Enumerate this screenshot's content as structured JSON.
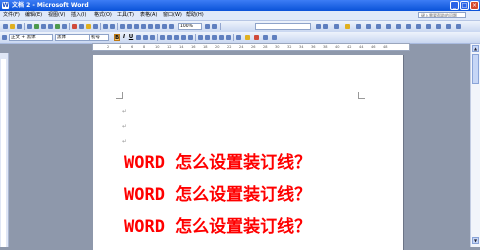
{
  "window": {
    "title": "文档 2 - Microsoft Word",
    "app_icon": "word-icon"
  },
  "menu": [
    "文件(F)",
    "编辑(E)",
    "视图(V)",
    "插入(I)",
    "格式(O)",
    "工具(T)",
    "表格(A)",
    "窗口(W)",
    "帮助(H)"
  ],
  "help_box": {
    "placeholder": "键入需要帮助的问题"
  },
  "toolbar": {
    "zoom": "100%"
  },
  "format_toolbar": {
    "style": "正文 + 黑体",
    "font": "黑体",
    "size": "初号",
    "bold": "B",
    "italic": "I",
    "underline": "U"
  },
  "ruler": {
    "marks": [
      "2",
      "4",
      "6",
      "8",
      "10",
      "12",
      "14",
      "16",
      "18",
      "20",
      "22",
      "24",
      "26",
      "28",
      "30",
      "32",
      "34",
      "36",
      "38",
      "40",
      "42",
      "44",
      "46",
      "48"
    ]
  },
  "document": {
    "paragraph_mark": "↵",
    "lines": [
      "WORD 怎么设置装订线？",
      "WORD 怎么设置装订线？",
      "WORD 怎么设置装订线？"
    ],
    "text_color": "#ff0000"
  },
  "colors": {
    "title_bar": "#0a52d8",
    "workspace": "#8e98ab",
    "close_button": "#d4462b"
  }
}
